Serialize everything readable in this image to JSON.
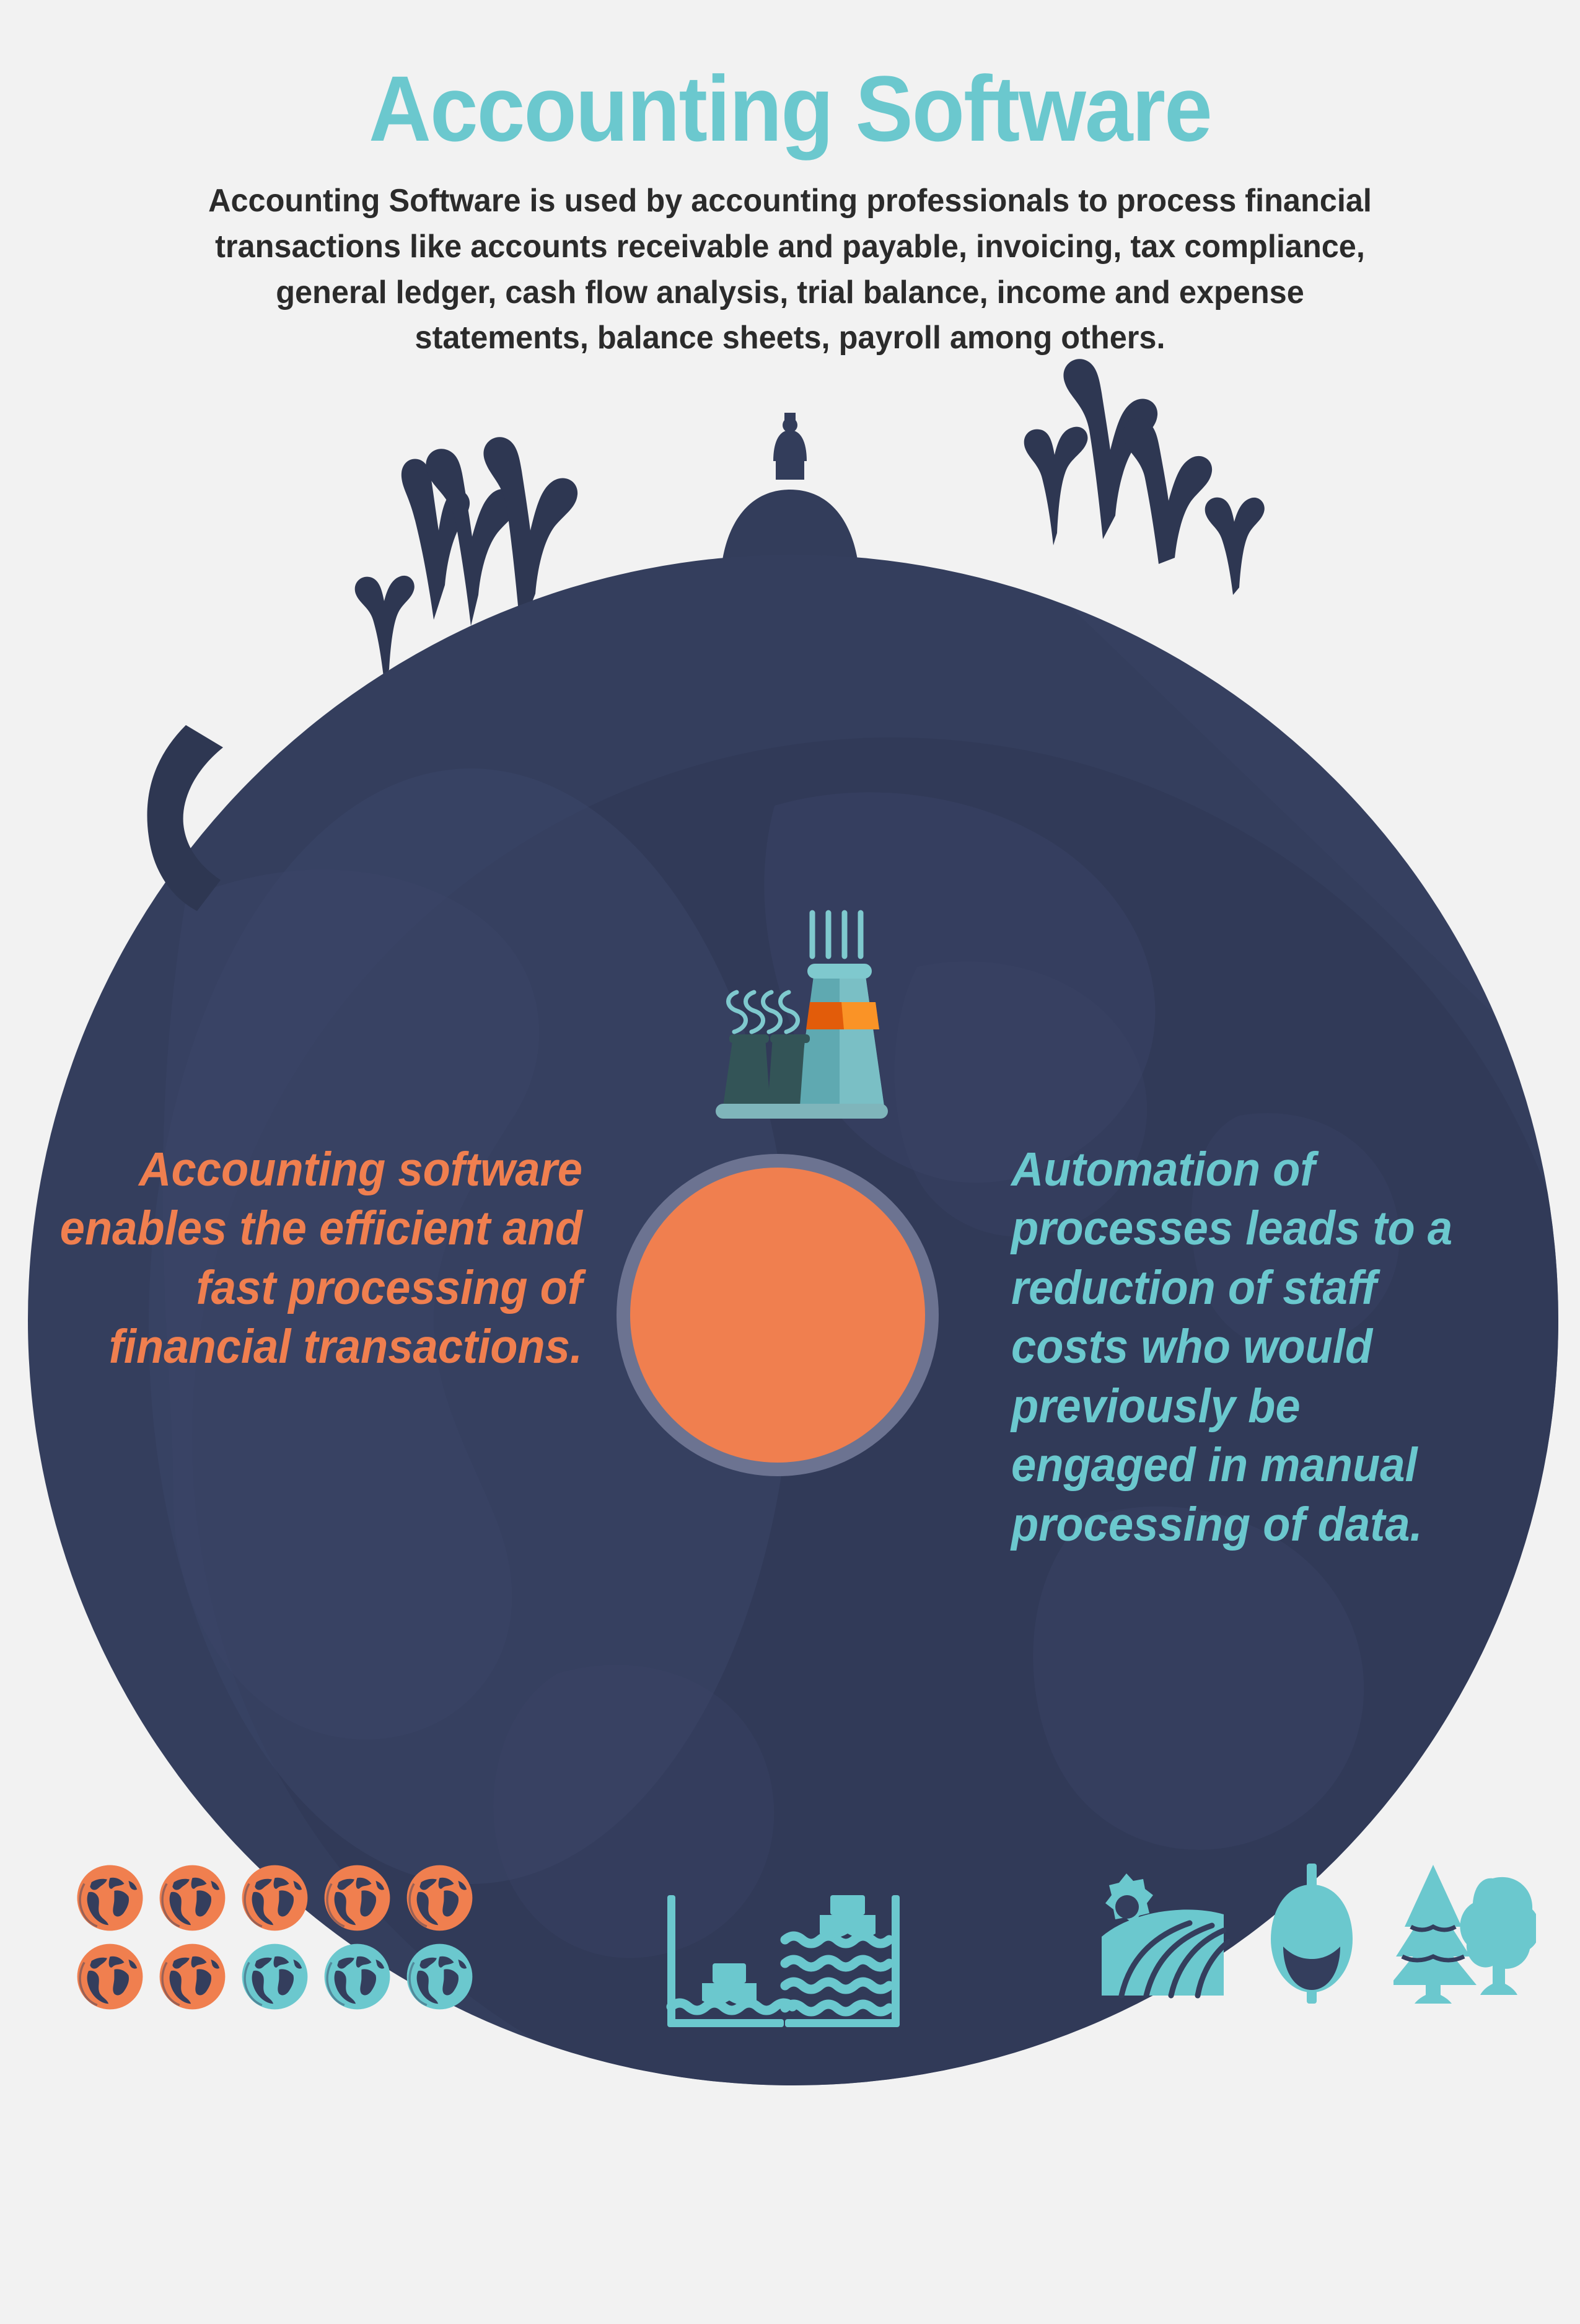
{
  "page": {
    "background_color": "#F2F2F2",
    "globe_color": "#343E5D",
    "accent_orange": "#F07F4F",
    "accent_teal": "#6BC8CE",
    "ring_color": "#6C7391",
    "body_text_color": "#2B2B2B"
  },
  "header": {
    "title": "Accounting Software",
    "subtitle": "Accounting Software is used by accounting professionals to process financial transactions like accounts receivable and payable, invoicing,  tax compliance, general ledger, cash flow analysis, trial balance,  income and expense statements, balance sheets, payroll among others."
  },
  "callouts": {
    "left": "Accounting software enables the efficient and fast processing of financial transactions.",
    "right": "Automation of processes leads to a reduction of staff costs who would previously be engaged in manual processing of data."
  },
  "icons": {
    "factory": "factory-icon",
    "capitol": "capitol-dome-icon",
    "branches": "bare-branches-icon",
    "center_circle": "orange-circle-marker",
    "canal_lock": "canal-lock-boats-icon",
    "field": "field-with-sun-icon",
    "balloon": "balloon-seed-icon",
    "trees": "trees-icon"
  },
  "globe_chips": {
    "label": "globe-chips",
    "rows": [
      [
        "orange",
        "orange",
        "orange",
        "orange",
        "orange"
      ],
      [
        "orange",
        "orange",
        "teal",
        "teal",
        "teal"
      ]
    ],
    "orange_count": 7,
    "teal_count": 3,
    "total": 10
  }
}
